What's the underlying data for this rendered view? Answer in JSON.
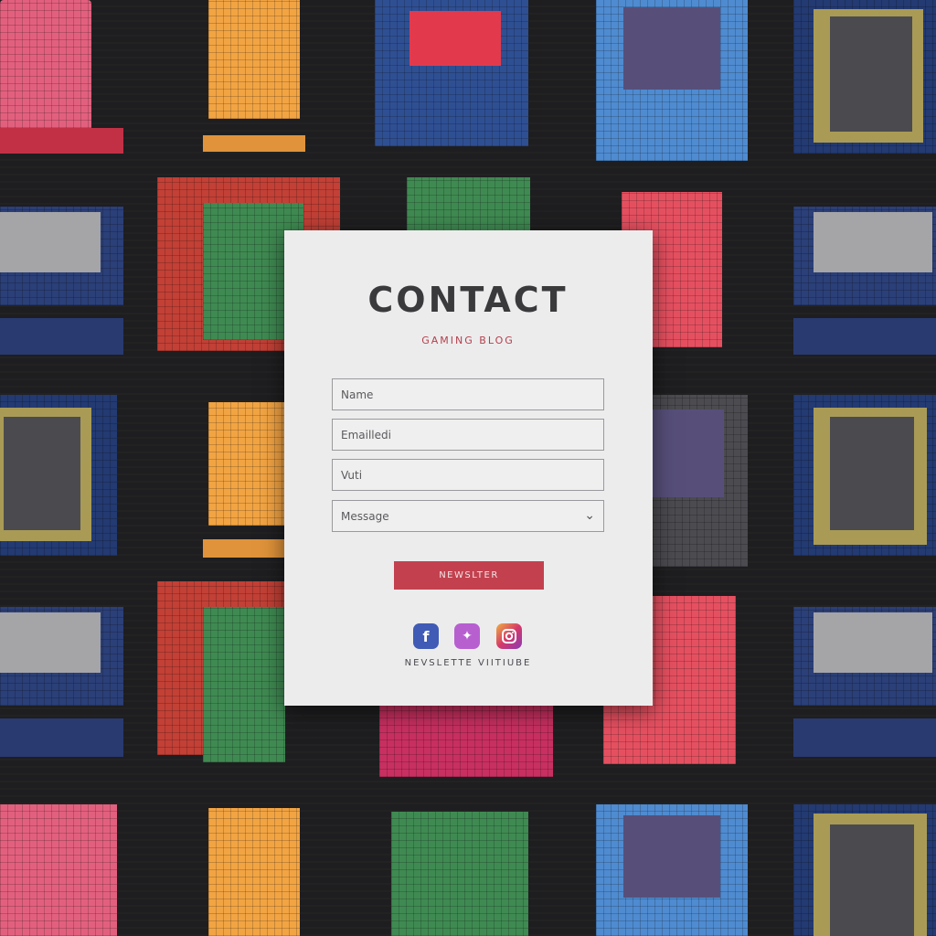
{
  "contact": {
    "title": "CONTACT",
    "subtitle": "GAMING BLOG",
    "fields": [
      {
        "placeholder": "Name"
      },
      {
        "placeholder": "Emailledi"
      },
      {
        "placeholder": "Vuti"
      },
      {
        "placeholder": "Message"
      }
    ],
    "submit_label": "NEWSLTER",
    "social_icons": [
      "facebook-icon",
      "twitter-icon",
      "instagram-icon"
    ],
    "footer_text": "NEVSLETTE VIITIUBE"
  },
  "colors": {
    "accent": "#c3414f",
    "card_bg": "#ececed",
    "page_bg": "#1e1e20"
  }
}
